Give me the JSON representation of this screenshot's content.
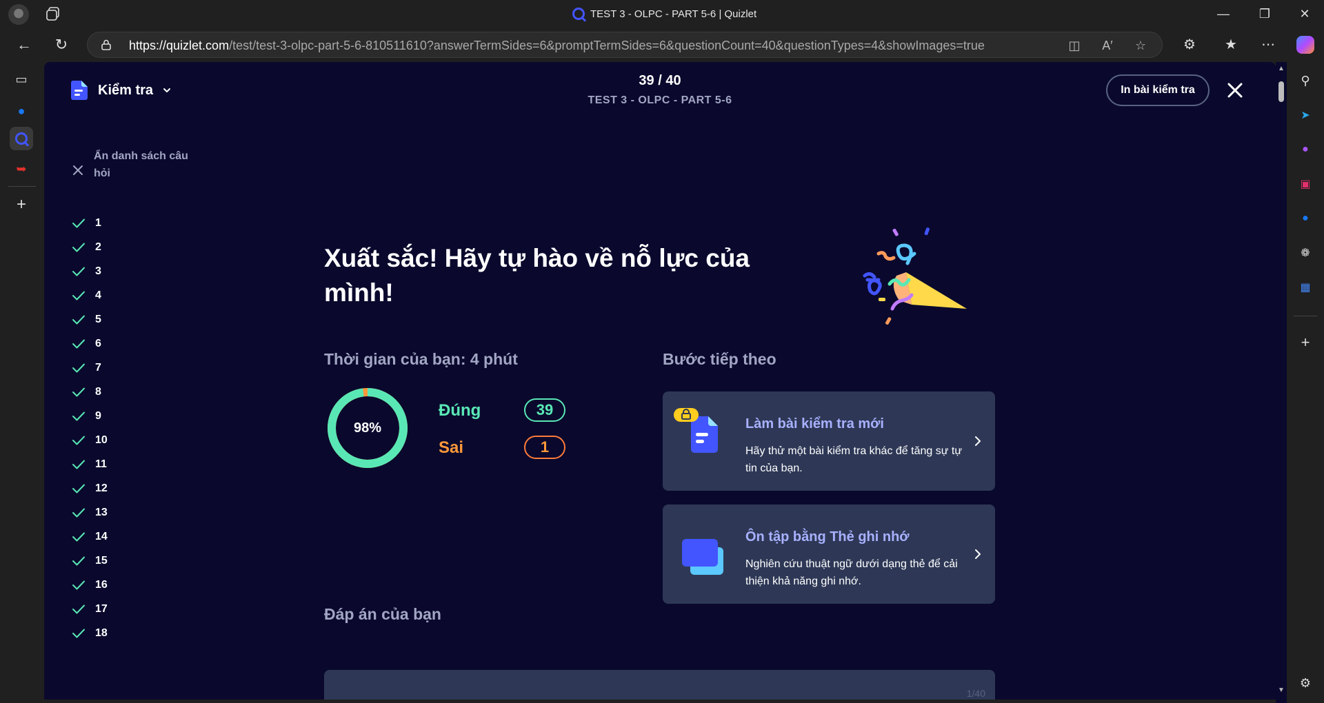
{
  "browser": {
    "tab_title": "TEST 3 - OLPC - PART 5-6 | Quizlet",
    "url_host": "https://quizlet.com",
    "url_path": "/test/test-3-olpc-part-5-6-810511610?answerTermSides=6&promptTermSides=6&questionCount=40&questionTypes=4&showImages=true",
    "window_controls": [
      "minimize-icon",
      "restore-icon",
      "close-icon"
    ]
  },
  "header": {
    "mode_label": "Kiểm tra",
    "progress_count": "39 / 40",
    "set_title": "TEST 3 - OLPC - PART 5-6",
    "print_button": "In bài kiểm tra"
  },
  "sidebar": {
    "hide_list_label": "Ẩn danh sách câu hỏi",
    "questions": [
      "1",
      "2",
      "3",
      "4",
      "5",
      "6",
      "7",
      "8",
      "9",
      "10",
      "11",
      "12",
      "13",
      "14",
      "15",
      "16",
      "17",
      "18"
    ]
  },
  "results": {
    "headline": "Xuất sắc! Hãy tự hào về nỗ lực của mình!",
    "time_label": "Thời gian của bạn: 4 phút",
    "percent_text": "98%",
    "score_fraction": 0.98,
    "correct_label": "Đúng",
    "correct_count": "39",
    "wrong_label": "Sai",
    "wrong_count": "1"
  },
  "next_steps": {
    "heading": "Bước tiếp theo",
    "cards": [
      {
        "title": "Làm bài kiểm tra mới",
        "description": "Hãy thử một bài kiểm tra khác để tăng sự tự tin của bạn."
      },
      {
        "title": "Ôn tập bằng Thẻ ghi nhớ",
        "description": "Nghiên cứu thuật ngữ dưới dạng thẻ để cải thiện khả năng ghi nhớ."
      }
    ]
  },
  "answers": {
    "heading": "Đáp án của bạn",
    "first_count": "1/40"
  },
  "colors": {
    "page_bg": "#0a092d",
    "card_bg": "#2e3856",
    "accent_blue": "#4255ff",
    "correct_green": "#59e8b5",
    "wrong_orange": "#ff983a",
    "muted_text": "#a2a6c4"
  }
}
